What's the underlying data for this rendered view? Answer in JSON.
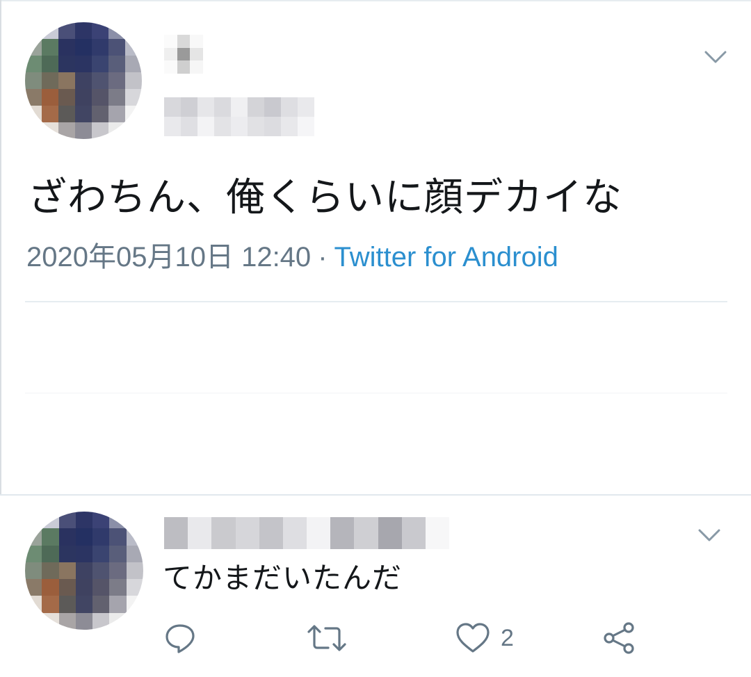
{
  "tweet": {
    "text": "ざわちん、俺くらいに顔デカイな",
    "date": "2020年05月10日 12:40",
    "separator": "·",
    "source": "Twitter for Android",
    "menu_icon": "chevron-down-icon"
  },
  "reply": {
    "text": "てかまだいたんだ",
    "menu_icon": "chevron-down-icon",
    "actions": {
      "reply_icon": "reply-icon",
      "retweet_icon": "retweet-icon",
      "like_icon": "heart-icon",
      "like_count": "2",
      "share_icon": "share-icon"
    }
  },
  "colors": {
    "text": "#14171a",
    "secondary": "#657786",
    "link": "#2b8fcf",
    "divider": "#e6ecf0"
  }
}
